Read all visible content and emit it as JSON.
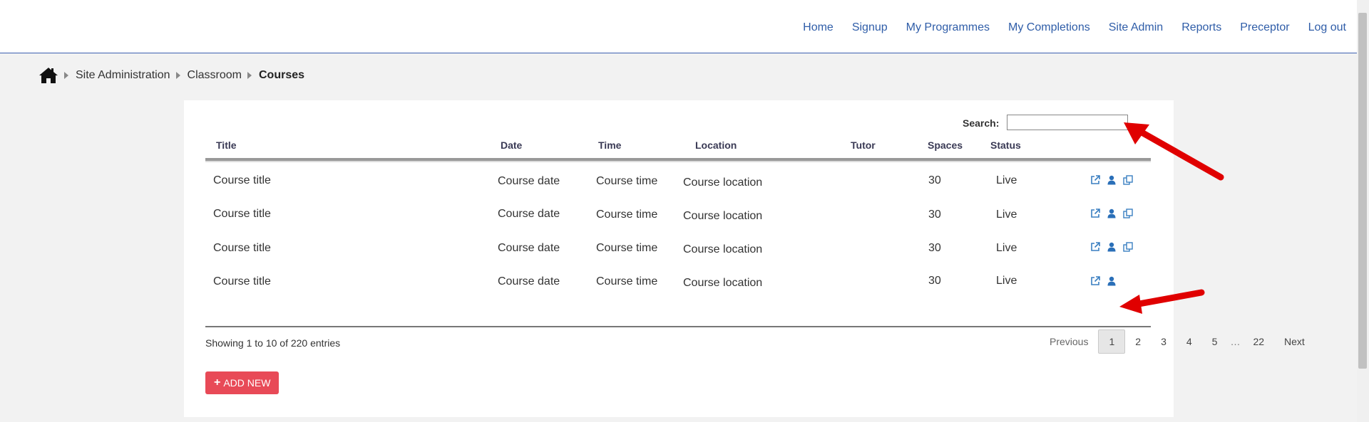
{
  "nav": {
    "items": [
      "Home",
      "Signup",
      "My Programmes",
      "My Completions",
      "Site Admin",
      "Reports",
      "Preceptor",
      "Log out"
    ]
  },
  "breadcrumb": {
    "home_icon": "home-icon",
    "items": [
      "Site Administration",
      "Classroom",
      "Courses"
    ]
  },
  "search": {
    "label": "Search:",
    "value": ""
  },
  "table": {
    "columns": [
      "Title",
      "Date",
      "Time",
      "Location",
      "Tutor",
      "Spaces",
      "Status"
    ],
    "rows": [
      {
        "title": "Course title",
        "date": "Course date",
        "time": "Course time",
        "location": "Course location",
        "tutor": "",
        "spaces": "30",
        "status": "Live",
        "actions": [
          "external-link-icon",
          "user-icon",
          "copy-icon"
        ]
      },
      {
        "title": "Course title",
        "date": "Course date",
        "time": "Course time",
        "location": "Course location",
        "tutor": "",
        "spaces": "30",
        "status": "Live",
        "actions": [
          "external-link-icon",
          "user-icon",
          "copy-icon"
        ]
      },
      {
        "title": "Course title",
        "date": "Course date",
        "time": "Course time",
        "location": "Course location",
        "tutor": "",
        "spaces": "30",
        "status": "Live",
        "actions": [
          "external-link-icon",
          "user-icon",
          "copy-icon"
        ]
      },
      {
        "title": "Course title",
        "date": "Course date",
        "time": "Course time",
        "location": "Course location",
        "tutor": "",
        "spaces": "30",
        "status": "Live",
        "actions": [
          "external-link-icon",
          "user-icon"
        ]
      }
    ]
  },
  "info": "Showing 1 to 10 of 220 entries",
  "pagination": {
    "previous": "Previous",
    "pages": [
      "1",
      "2",
      "3",
      "4",
      "5"
    ],
    "ellipsis": "…",
    "last": "22",
    "next": "Next",
    "current": "1"
  },
  "add_button": {
    "icon": "+",
    "label": "ADD NEW"
  },
  "colors": {
    "accent": "#2f5da8",
    "button": "#e84a57",
    "arrow": "#e00000"
  }
}
